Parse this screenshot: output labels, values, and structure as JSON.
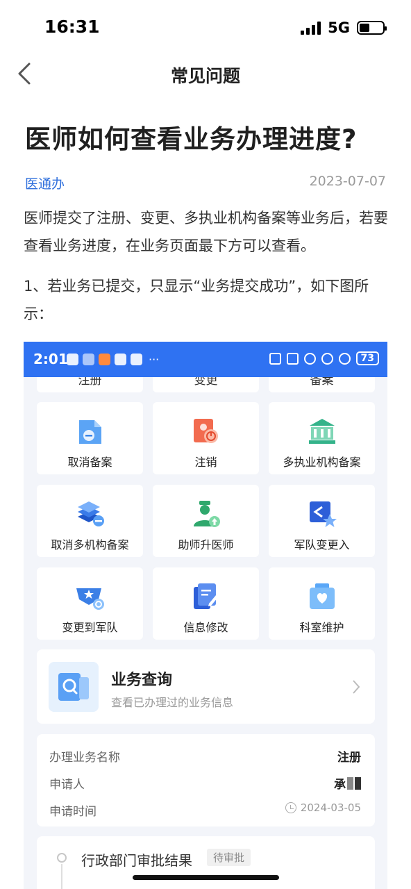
{
  "status_bar": {
    "time": "16:31",
    "network": "5G"
  },
  "nav": {
    "title": "常见问题"
  },
  "article": {
    "title": "医师如何查看业务办理进度?",
    "source": "医通办",
    "date": "2023-07-07",
    "para1": "医师提交了注册、变更、多执业机构备案等业务后，若要查看业务进度，在业务页面最下方可以查看。",
    "para2": "1、若业务已提交，只显示“业务提交成功”，如下图所示："
  },
  "screenshot": {
    "status_time": "2:01",
    "dots": "···",
    "battery": "73",
    "cut_labels": [
      "注册",
      "变更",
      "备案"
    ],
    "grid": [
      {
        "label": "取消备案",
        "icon": "cancel-filing-icon"
      },
      {
        "label": "注销",
        "icon": "deregister-icon"
      },
      {
        "label": "多执业机构备案",
        "icon": "institution-icon"
      },
      {
        "label": "取消多机构备案",
        "icon": "cancel-multi-filing-icon"
      },
      {
        "label": "助师升医师",
        "icon": "promote-doctor-icon"
      },
      {
        "label": "军队变更入",
        "icon": "military-in-icon"
      },
      {
        "label": "变更到军队",
        "icon": "to-military-icon"
      },
      {
        "label": "信息修改",
        "icon": "edit-info-icon"
      },
      {
        "label": "科室维护",
        "icon": "department-icon"
      }
    ],
    "query": {
      "title": "业务查询",
      "subtitle": "查看已办理过的业务信息"
    },
    "info": {
      "business_name_label": "办理业务名称",
      "business_name_value": "注册",
      "applicant_label": "申请人",
      "applicant_value": "承",
      "time_label": "申请时间",
      "time_value": "2024-03-05"
    },
    "approval": {
      "title": "行政部门审批结果",
      "badge": "待审批"
    }
  }
}
